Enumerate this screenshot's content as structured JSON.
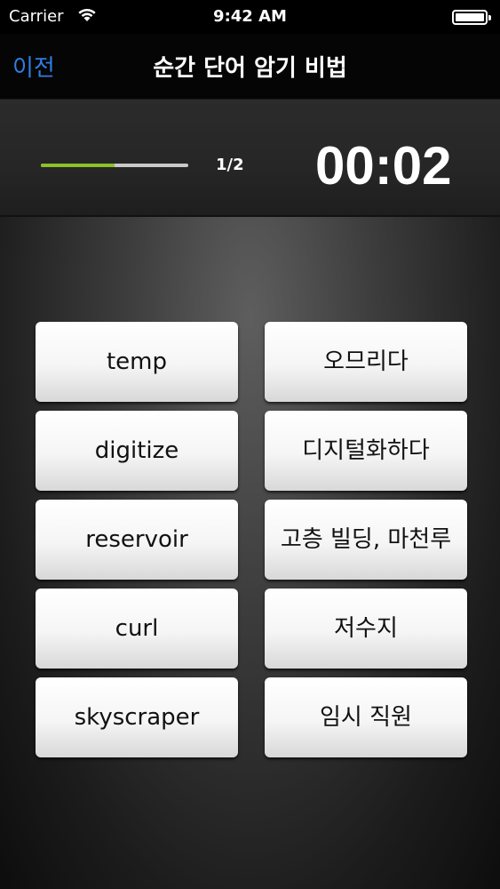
{
  "status_bar": {
    "carrier": "Carrier",
    "time": "9:42 AM",
    "wifi_icon": "wifi-icon",
    "battery_icon": "battery-icon"
  },
  "nav": {
    "back_label": "이전",
    "title": "순간 단어 암기 비법"
  },
  "progress": {
    "fraction": 0.5,
    "count_text": "1/2",
    "fill_color": "#8bc22b"
  },
  "timer": {
    "text": "00:02"
  },
  "cards": {
    "left": [
      {
        "label": "temp"
      },
      {
        "label": "digitize"
      },
      {
        "label": "reservoir"
      },
      {
        "label": "curl"
      },
      {
        "label": "skyscraper"
      }
    ],
    "right": [
      {
        "label": "오므리다"
      },
      {
        "label": "디지털화하다"
      },
      {
        "label": "고층 빌딩, 마천루"
      },
      {
        "label": "저수지"
      },
      {
        "label": "임시 직원"
      }
    ]
  },
  "colors": {
    "back_link": "#2f7de1",
    "background": "#000000"
  }
}
